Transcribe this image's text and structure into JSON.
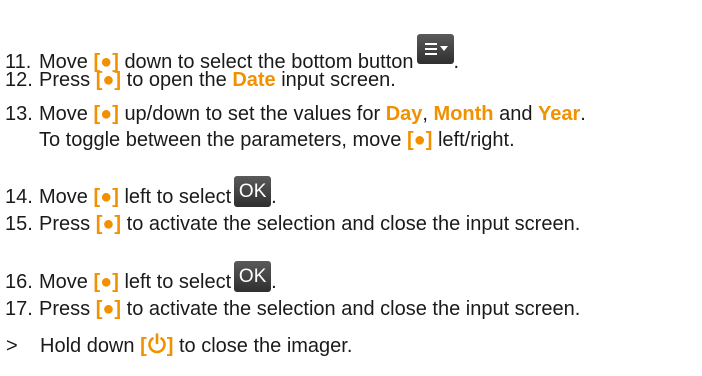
{
  "ctl_symbol": "[●]",
  "power_open": "[",
  "power_close": "]",
  "ok_label": "OK",
  "steps": [
    {
      "num": "11.",
      "a": "Move",
      "b": "down to select the bottom button"
    },
    {
      "num": "12.",
      "a": "Press",
      "b": "to open the",
      "kw": "Date",
      "c": "input screen."
    },
    {
      "num": "13.",
      "a": "Move",
      "b": "up/down to set the values for",
      "kw1": "Day",
      "sep1": ",",
      "kw2": "Month",
      "sep2": "and",
      "kw3": "Year",
      "end": ".",
      "line2a": "To toggle between the parameters, move",
      "line2b": "left/right."
    },
    {
      "num": "14.",
      "a": "Move",
      "b": "left to select"
    },
    {
      "num": "15.",
      "a": "Press",
      "b": "to activate the selection and close the input screen."
    },
    {
      "num": "16.",
      "a": "Move",
      "b": "left to select"
    },
    {
      "num": "17.",
      "a": "Press",
      "b": "to activate the selection and close the input screen."
    },
    {
      "num": ">",
      "a": "Hold down",
      "b": "to close the imager."
    }
  ],
  "colors": {
    "accent": "#f29100",
    "text": "#1a1a1a",
    "button": "#3c3c3c"
  }
}
